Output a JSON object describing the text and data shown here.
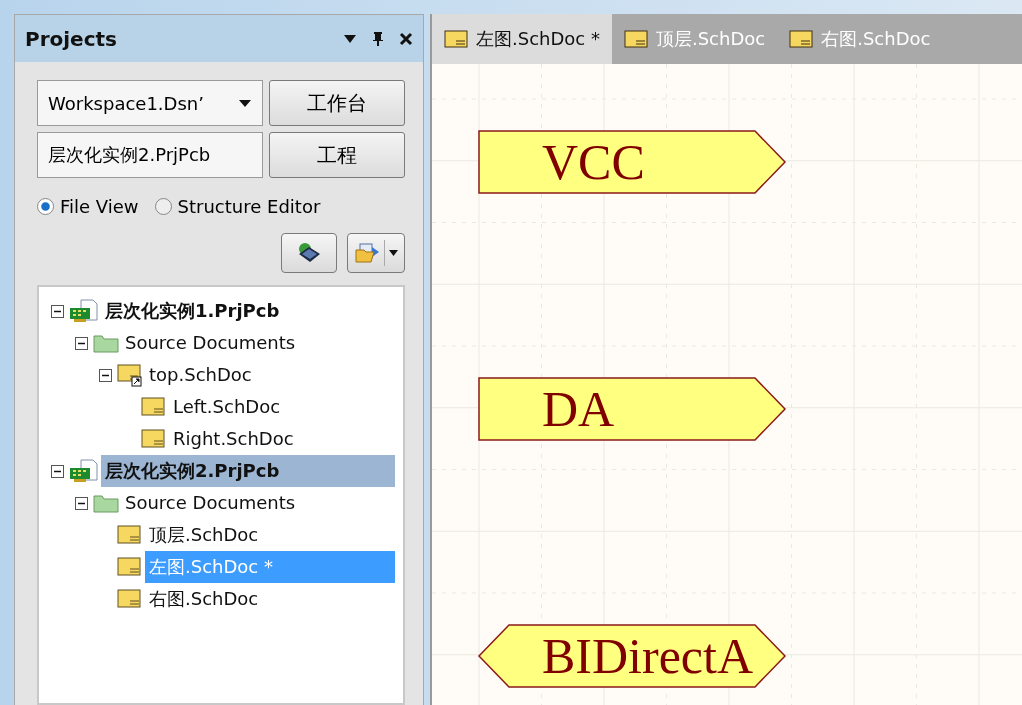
{
  "panel": {
    "title": "Projects",
    "workspace": {
      "value": "Workspace1.Dsnʼ"
    },
    "workspace_button": "工作台",
    "project": {
      "value": "层次化实例2.PrjPcb"
    },
    "project_button": "工程",
    "views": [
      {
        "label": "File View",
        "selected": true
      },
      {
        "label": "Structure Editor",
        "selected": false
      }
    ],
    "tree": [
      {
        "kind": "project",
        "label": "层次化实例1.PrjPcb",
        "expanded": true,
        "selected": false,
        "highlighted": false,
        "children": [
          {
            "kind": "folder",
            "label": "Source Documents",
            "expanded": true,
            "selected": false,
            "highlighted": false,
            "children": [
              {
                "kind": "sheet",
                "label": "top.SchDoc",
                "expanded": true,
                "selected": false,
                "highlighted": false,
                "children": [
                  {
                    "kind": "document",
                    "label": "Left.SchDoc",
                    "selected": false,
                    "highlighted": false
                  },
                  {
                    "kind": "document",
                    "label": "Right.SchDoc",
                    "selected": false,
                    "highlighted": false
                  }
                ]
              }
            ]
          }
        ]
      },
      {
        "kind": "project",
        "label": "层次化实例2.PrjPcb",
        "expanded": true,
        "selected": false,
        "highlighted": true,
        "children": [
          {
            "kind": "folder",
            "label": "Source Documents",
            "expanded": true,
            "selected": false,
            "highlighted": false,
            "children": [
              {
                "kind": "document",
                "label": "顶层.SchDoc",
                "selected": false,
                "highlighted": false
              },
              {
                "kind": "document",
                "label": "左图.SchDoc *",
                "selected": true,
                "highlighted": false
              },
              {
                "kind": "document",
                "label": "右图.SchDoc",
                "selected": false,
                "highlighted": false
              }
            ]
          }
        ]
      }
    ]
  },
  "tabs": [
    {
      "label": "左图.SchDoc *",
      "selected": true
    },
    {
      "label": "顶层.SchDoc",
      "selected": false
    },
    {
      "label": "右图.SchDoc",
      "selected": false
    }
  ],
  "ports": [
    {
      "kind": "output",
      "label": "VCC"
    },
    {
      "kind": "output",
      "label": "DA"
    },
    {
      "kind": "bidirectional",
      "label": "BIDirectA"
    }
  ]
}
